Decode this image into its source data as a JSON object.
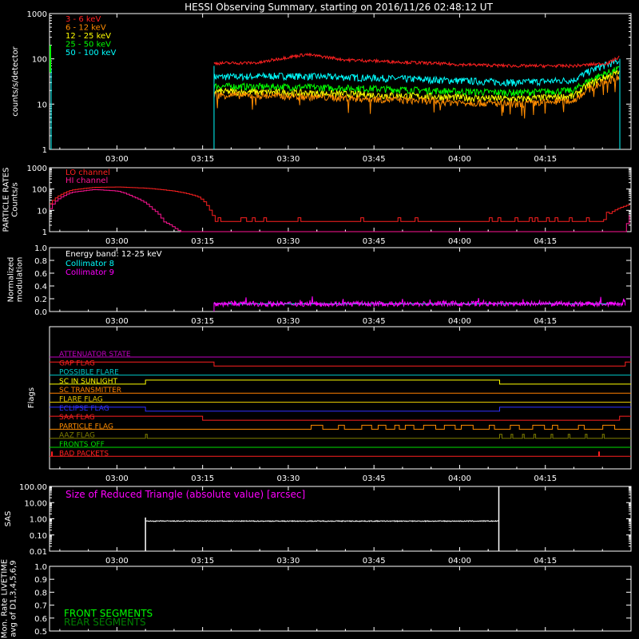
{
  "title": "HESSI Observing Summary, starting on 2016/11/26 02:48:12 UT",
  "time_ticks": [
    "03:00",
    "03:15",
    "03:30",
    "03:45",
    "04:00",
    "04:15"
  ],
  "time_axis": {
    "start": "02:48:12",
    "end": "04:30:00",
    "tick_minutes_from_start": [
      11.8,
      26.8,
      41.8,
      56.8,
      71.8,
      86.8
    ]
  },
  "chart_data": [
    {
      "type": "line",
      "name": "lightcurves",
      "ylabel": "counts/s/detector",
      "yscale": "log",
      "ylim": [
        1,
        1000
      ],
      "yticks": [
        "1",
        "10",
        "100",
        "1000"
      ],
      "data_gap": [
        "02:48:12",
        "03:17"
      ],
      "series": [
        {
          "name": "3 - 6 keV",
          "color": "#ff2020",
          "x": [
            "03:17",
            "03:25",
            "03:33",
            "03:40",
            "03:50",
            "04:00",
            "04:10",
            "04:20",
            "04:26",
            "04:28"
          ],
          "values": [
            80,
            82,
            125,
            95,
            85,
            75,
            70,
            70,
            80,
            110
          ]
        },
        {
          "name": "6 - 12 keV",
          "color": "#ff8c00",
          "x": [
            "03:17",
            "03:30",
            "03:45",
            "04:00",
            "04:10",
            "04:20",
            "04:28"
          ],
          "values": [
            16,
            15,
            13,
            11,
            10,
            12,
            40
          ]
        },
        {
          "name": "12 - 25 keV",
          "color": "#ffff00",
          "x": [
            "03:17",
            "03:30",
            "03:45",
            "04:00",
            "04:10",
            "04:20",
            "04:28"
          ],
          "values": [
            19,
            18,
            16,
            14,
            13,
            15,
            50
          ]
        },
        {
          "name": "25 - 50 keV",
          "color": "#00ff00",
          "x": [
            "03:17",
            "03:30",
            "03:45",
            "04:00",
            "04:10",
            "04:20",
            "04:28"
          ],
          "values": [
            25,
            24,
            22,
            19,
            18,
            20,
            60
          ]
        },
        {
          "name": "50 - 100 keV",
          "color": "#00ffff",
          "x": [
            "03:17",
            "03:30",
            "03:45",
            "04:00",
            "04:10",
            "04:20",
            "04:28"
          ],
          "values": [
            40,
            42,
            38,
            33,
            30,
            34,
            90
          ]
        }
      ]
    },
    {
      "type": "line",
      "name": "particle_rates",
      "ylabel": "PARTICLE RATES Counts/s",
      "yscale": "log",
      "ylim": [
        1,
        1000
      ],
      "yticks": [
        "1",
        "10",
        "100",
        "1000"
      ],
      "series": [
        {
          "name": "LO channel",
          "color": "#ff2020",
          "x": [
            "02:48:12",
            "02:52",
            "02:56",
            "03:00",
            "03:05",
            "03:10",
            "03:14",
            "03:16",
            "03:17",
            "03:45",
            "04:25",
            "04:30"
          ],
          "values": [
            20,
            90,
            120,
            125,
            110,
            80,
            45,
            12,
            3,
            3,
            3,
            20
          ]
        },
        {
          "name": "HI channel",
          "color": "#ff1493",
          "x": [
            "02:48:12",
            "02:52",
            "02:56",
            "03:00",
            "03:03",
            "03:06",
            "03:08",
            "03:10",
            "03:11",
            "04:29",
            "04:30"
          ],
          "values": [
            12,
            70,
            95,
            80,
            40,
            12,
            3,
            1.5,
            1,
            1,
            8
          ]
        }
      ]
    },
    {
      "type": "line",
      "name": "modulation",
      "ylabel": "Normalized modulation",
      "ylim": [
        0,
        1
      ],
      "yticks": [
        "0.0",
        "0.2",
        "0.4",
        "0.6",
        "0.8",
        "1.0"
      ],
      "annotation": "Energy band: 12-25 keV",
      "series": [
        {
          "name": "Collimator 8",
          "color": "#00ffff",
          "x": [
            "03:17",
            "04:30"
          ],
          "values": [
            0.12,
            0.12
          ]
        },
        {
          "name": "Collimator 9",
          "color": "#ff00ff",
          "x": [
            "03:17",
            "03:40",
            "04:00",
            "04:30"
          ],
          "values": [
            0.12,
            0.12,
            0.12,
            0.12
          ]
        }
      ]
    },
    {
      "type": "step",
      "name": "flags",
      "ylabel": "Flags",
      "flags": [
        {
          "name": "ATTENUATOR STATE",
          "color": "#c000c0",
          "steps": [
            [
              "02:48:12",
              0
            ],
            [
              "04:30",
              0
            ]
          ]
        },
        {
          "name": "GAP FLAG",
          "color": "#ff2020",
          "steps": [
            [
              "02:48:12",
              1
            ],
            [
              "03:17",
              0
            ],
            [
              "04:29",
              1
            ]
          ]
        },
        {
          "name": "POSSIBLE FLARE",
          "color": "#00c8c8",
          "steps": [
            [
              "02:48:12",
              0
            ],
            [
              "04:30",
              0
            ]
          ]
        },
        {
          "name": "SC IN SUNLIGHT",
          "color": "#ffff00",
          "steps": [
            [
              "02:48:12",
              0
            ],
            [
              "03:05",
              1
            ],
            [
              "04:07",
              0
            ]
          ]
        },
        {
          "name": "SC TRANSMITTER",
          "color": "#ff8000",
          "steps": [
            [
              "02:48:12",
              0
            ],
            [
              "04:30",
              0
            ]
          ]
        },
        {
          "name": "FLARE FLAG",
          "color": "#e6c800",
          "steps": [
            [
              "02:48:12",
              0
            ],
            [
              "04:30",
              0
            ]
          ]
        },
        {
          "name": "ECLIPSE FLAG",
          "color": "#3030ff",
          "steps": [
            [
              "02:48:12",
              1
            ],
            [
              "03:05",
              0
            ],
            [
              "04:07",
              1
            ]
          ]
        },
        {
          "name": "SAA FLAG",
          "color": "#ff2020",
          "steps": [
            [
              "02:48:12",
              1
            ],
            [
              "03:15",
              0
            ],
            [
              "04:28",
              1
            ]
          ]
        },
        {
          "name": "PARTICLE FLAG",
          "color": "#ff8c00",
          "steps": [
            [
              "02:48:12",
              0
            ],
            [
              "03:34",
              1
            ],
            [
              "04:28",
              0
            ]
          ]
        },
        {
          "name": "AAZ FLAG",
          "color": "#808000",
          "steps": [
            [
              "02:48:12",
              0
            ],
            [
              "04:30",
              0
            ]
          ]
        },
        {
          "name": "FRONTS OFF",
          "color": "#00e000",
          "steps": [
            [
              "02:48:12",
              0
            ],
            [
              "04:30",
              0
            ]
          ]
        },
        {
          "name": "BAD PACKETS",
          "color": "#ff2020",
          "steps": [
            [
              "02:48:12",
              0
            ],
            [
              "04:30",
              0
            ]
          ]
        }
      ]
    },
    {
      "type": "line",
      "name": "sas",
      "ylabel": "SAS",
      "yscale": "log",
      "ylim": [
        0.01,
        100
      ],
      "yticks": [
        "0.01",
        "0.10",
        "1.00",
        "10.00",
        "100.00"
      ],
      "annotation": "Size of Reduced Triangle (absolute value) [arcsec]",
      "series": [
        {
          "name": "Size of Reduced Triangle (absolute value) [arcsec]",
          "color": "#ffffff",
          "x": [
            "03:05",
            "03:06",
            "03:30",
            "04:00",
            "04:06",
            "04:07"
          ],
          "values": [
            0.01,
            0.75,
            0.7,
            0.7,
            0.72,
            0.01
          ]
        }
      ]
    },
    {
      "type": "line",
      "name": "livetime",
      "ylabel": "Mon. Rate LIVETIME avg of D1,3,4,5,6,9",
      "ylim": [
        0.5,
        1.0
      ],
      "yticks": [
        "0.5",
        "0.6",
        "0.7",
        "0.8",
        "0.9",
        "1.0"
      ],
      "series": [
        {
          "name": "FRONT SEGMENTS",
          "color": "#00ff00",
          "x": [],
          "values": []
        },
        {
          "name": "REAR SEGMENTS",
          "color": "#008000",
          "x": [],
          "values": []
        }
      ]
    }
  ]
}
